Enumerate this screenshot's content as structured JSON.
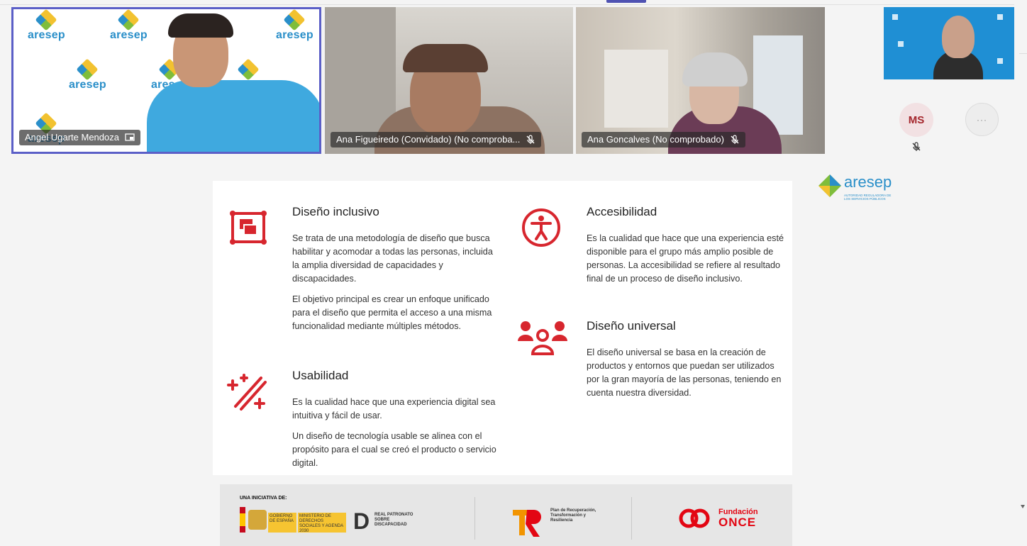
{
  "meeting": {
    "participants": [
      {
        "name": "Angel Ugarte Mendoza",
        "status_icon": "screen-share-icon"
      },
      {
        "name": "Ana Figueiredo (Convidado) (No comproba...",
        "status_icon": "mic-off-icon"
      },
      {
        "name": "Ana Goncalves (No comprobado)",
        "status_icon": "mic-off-icon"
      }
    ],
    "ms_initials": "MS",
    "more_label": "···",
    "background_brand": "aresep"
  },
  "slide": {
    "sections": [
      {
        "title": "Diseño inclusivo",
        "icon": "inclusive-design-icon",
        "paragraphs": [
          "Se trata de una metodología de diseño que busca habilitar y acomodar a todas las personas, incluida la amplia diversidad de capacidades y discapacidades.",
          "El objetivo principal es crear un enfoque unificado para el diseño que permita el acceso a una misma funcionalidad mediante múltiples métodos."
        ]
      },
      {
        "title": "Usabilidad",
        "icon": "magic-wand-icon",
        "paragraphs": [
          "Es la cualidad hace que una experiencia digital sea intuitiva y fácil de usar.",
          "Un diseño de tecnología usable se alinea con el propósito para el cual se creó el producto o servicio digital."
        ]
      },
      {
        "title": "Accesibilidad",
        "icon": "accessibility-icon",
        "paragraphs": [
          "Es la cualidad que hace que una experiencia esté disponible para el grupo más amplio posible de personas. La accesibilidad se refiere al resultado final de un proceso de diseño inclusivo."
        ]
      },
      {
        "title": "Diseño universal",
        "icon": "people-group-icon",
        "paragraphs": [
          "El diseño universal se basa en la creación de productos y entornos que puedan ser utilizados por la gran mayoría de las personas, teniendo en cuenta nuestra diversidad."
        ]
      }
    ],
    "accent_color": "#d7262e"
  },
  "side_logo": {
    "text": "aresep",
    "subtitle": "AUTORIDAD REGULADORA DE LOS SERVICIOS PÚBLICOS"
  },
  "footer": {
    "initiative_label": "UNA INICIATIVA DE:",
    "gov_text_1": "GOBIERNO DE ESPAÑA",
    "gov_text_2": "MINISTERIO DE DERECHOS SOCIALES Y AGENDA 2030",
    "real_patronato": "REAL PATRONATO SOBRE DISCAPACIDAD",
    "plan_text": "Plan de Recuperación, Transformación y Resiliencia",
    "once_line1": "Fundación",
    "once_line2": "ONCE"
  }
}
